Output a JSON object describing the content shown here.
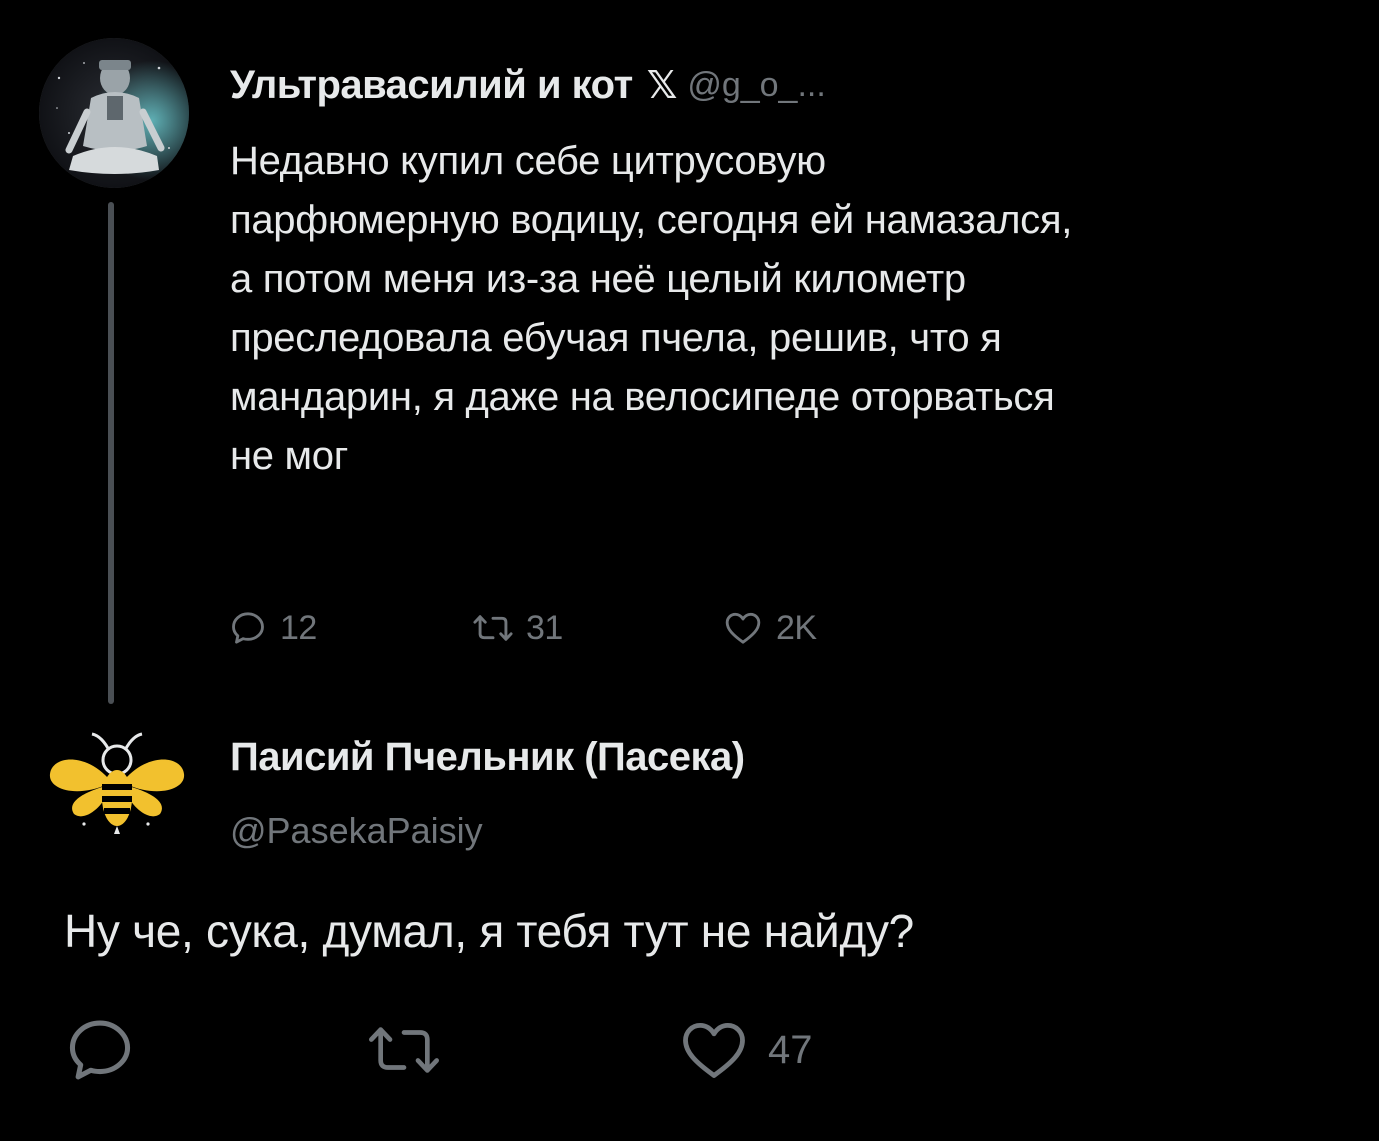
{
  "tweet_1": {
    "author_name": "Ультравасилий и кот",
    "verified_badge": "𝕏",
    "handle": "@g_o_...",
    "text": "Недавно купил себе цитрусовую\nпарфюмерную водицу, сегодня ей намазался,\nа потом меня из-за неё целый километр\nпреследовала ебучая пчела, решив, что я\nмандарин, я даже на велосипеде оторваться\nне мог",
    "actions": {
      "replies": "12",
      "retweets": "31",
      "likes": "2K"
    }
  },
  "tweet_2": {
    "author_name": "Паисий Пчельник (Пасека)",
    "handle": "@PasekaPaisiy",
    "text": "Ну че, сука, думал, я тебя тут не найду?",
    "actions": {
      "likes": "47"
    }
  },
  "icons": {
    "reply": "reply-icon",
    "retweet": "retweet-icon",
    "like": "heart-icon"
  },
  "colors": {
    "background": "#000000",
    "text_primary": "#e7e9ea",
    "text_secondary": "#71767b",
    "thread_line": "#4a4f54",
    "bee_yellow": "#f2c12e"
  }
}
